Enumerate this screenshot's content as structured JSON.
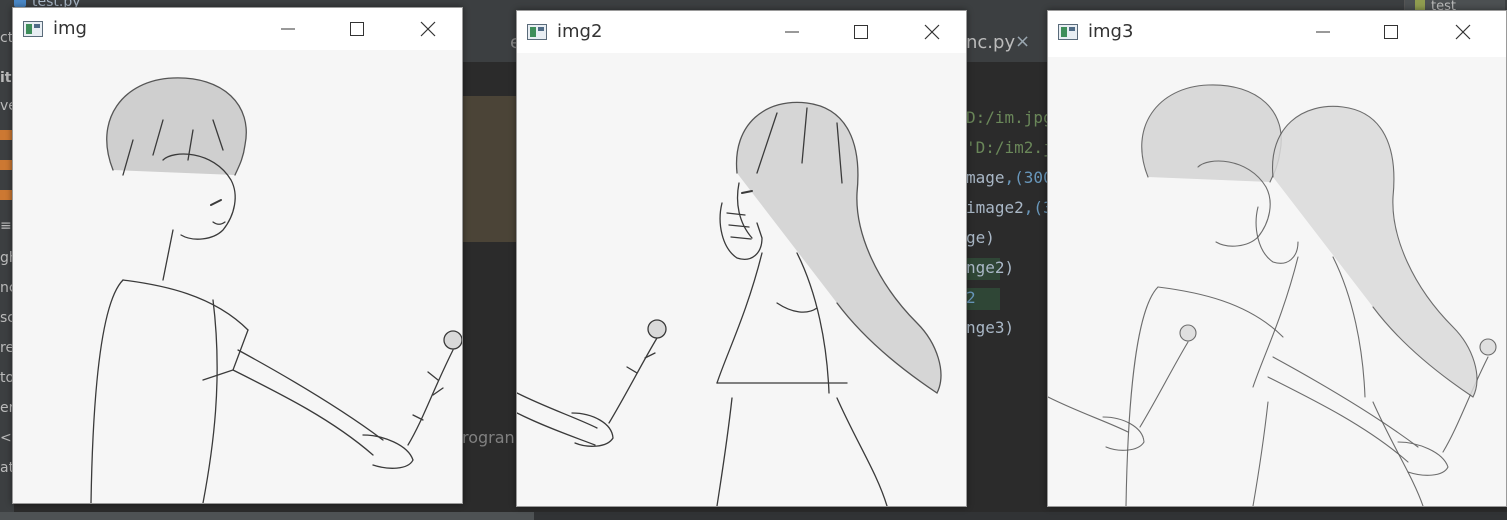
{
  "ide": {
    "file_tab": "test.py",
    "run_config": "test",
    "sidebar_fragments": [
      "ct",
      "it",
      "ve",
      "gh",
      "nc",
      "sc",
      "re",
      "to",
      "er",
      "<",
      "at"
    ],
    "mid_tab_fragment": "e",
    "mid_text_fragment": "rogran",
    "editor_tab": "nc.py",
    "editor_tab_close": "×",
    "code_lines": [
      {
        "pre": "",
        "str": "D:/im.jpg",
        "post": ""
      },
      {
        "pre": "",
        "str": "'D:/im2.j",
        "post": ""
      },
      {
        "pre": "mage",
        "str": "",
        "post": ",(300"
      },
      {
        "pre": "image2",
        "str": "",
        "post": ",(3"
      },
      {
        "pre": "ge)",
        "str": "",
        "post": ""
      },
      {
        "pre": "nge2)",
        "str": "",
        "post": ""
      },
      {
        "pre": "2",
        "str": "",
        "post": ""
      },
      {
        "pre": "nge3)",
        "str": "",
        "post": ""
      }
    ]
  },
  "windows": [
    {
      "title": "img",
      "minimize": "—",
      "maximize": "☐",
      "close": "✕",
      "image_icon": "boy-with-rose-sketch"
    },
    {
      "title": "img2",
      "minimize": "—",
      "maximize": "☐",
      "close": "✕",
      "image_icon": "girl-covering-face-sketch"
    },
    {
      "title": "img3",
      "minimize": "—",
      "maximize": "☐",
      "close": "✕",
      "image_icon": "blended-boy-girl-sketch"
    }
  ],
  "colors": {
    "ide_bg": "#2b2b2b",
    "ide_panel": "#3c3f41",
    "window_bg": "#ffffff",
    "canvas_bg": "#f6f6f6",
    "sketch_line": "#3a3a3a"
  }
}
